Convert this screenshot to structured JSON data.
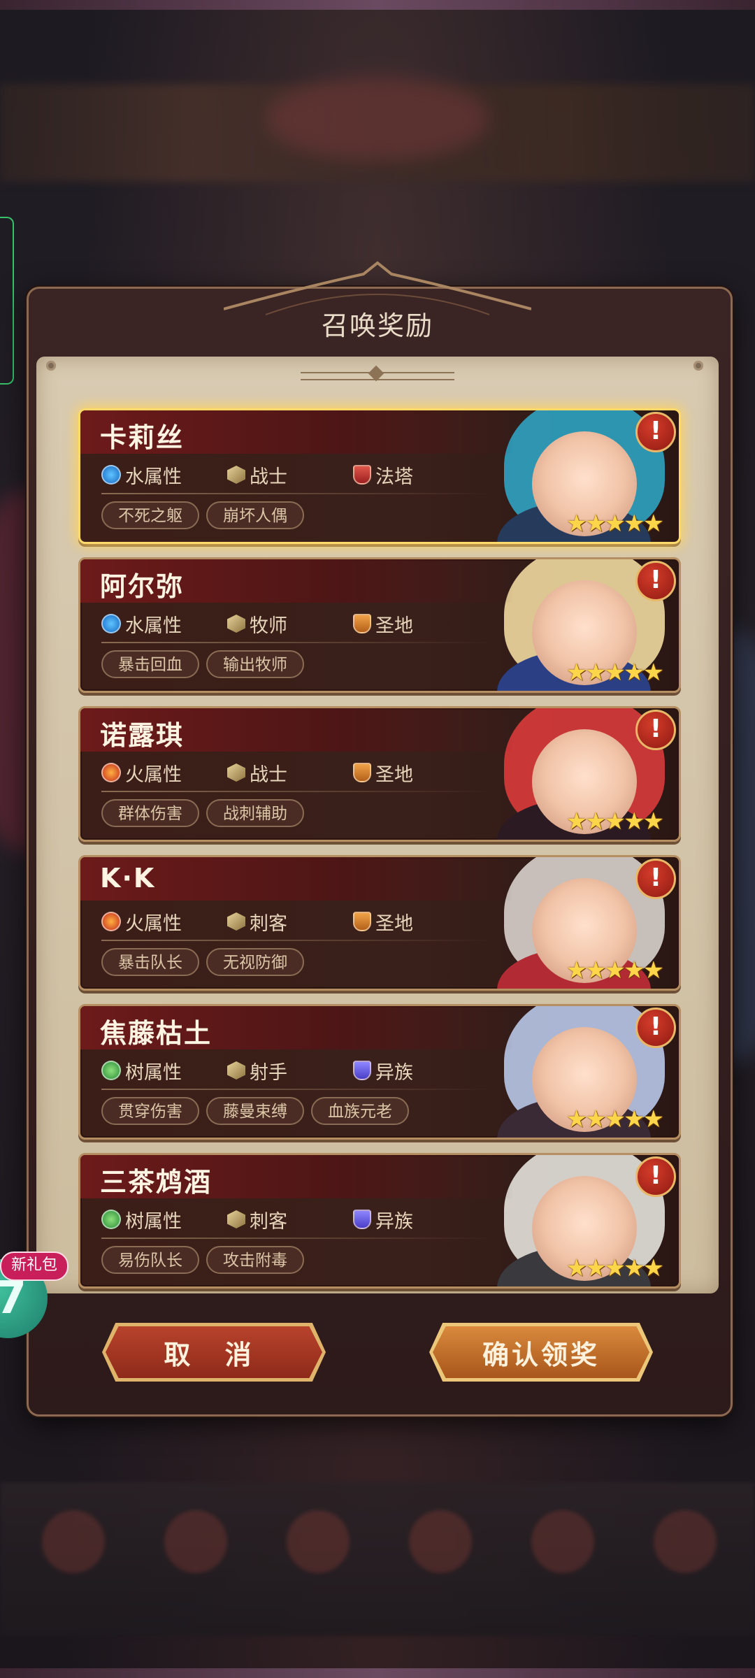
{
  "dialog": {
    "title": "召唤奖励",
    "cancel_label": "取 消",
    "confirm_label": "确认领奖"
  },
  "heroes": [
    {
      "name": "卡莉丝",
      "element": "水属性",
      "class": "战士",
      "faction": "法塔",
      "tags": [
        "不死之躯",
        "崩坏人偶"
      ],
      "stars": 5,
      "selected": true
    },
    {
      "name": "阿尔弥",
      "element": "水属性",
      "class": "牧师",
      "faction": "圣地",
      "tags": [
        "暴击回血",
        "输出牧师"
      ],
      "stars": 5,
      "selected": false
    },
    {
      "name": "诺露琪",
      "element": "火属性",
      "class": "战士",
      "faction": "圣地",
      "tags": [
        "群体伤害",
        "战刺辅助"
      ],
      "stars": 5,
      "selected": false
    },
    {
      "name": "K·K",
      "element": "火属性",
      "class": "刺客",
      "faction": "圣地",
      "tags": [
        "暴击队长",
        "无视防御"
      ],
      "stars": 5,
      "selected": false
    },
    {
      "name": "焦藤枯土",
      "element": "树属性",
      "class": "射手",
      "faction": "异族",
      "tags": [
        "贯穿伤害",
        "藤曼束缚",
        "血族元老"
      ],
      "stars": 5,
      "selected": false
    },
    {
      "name": "三茶鸩酒",
      "element": "树属性",
      "class": "刺客",
      "faction": "异族",
      "tags": [
        "易伤队长",
        "攻击附毒"
      ],
      "stars": 5,
      "selected": false
    }
  ],
  "alert_symbol": "!",
  "star_symbol": "★★★★★",
  "side_widget": {
    "gift_badge": "新礼包",
    "gift_number": "7"
  },
  "colors": {
    "selected_glow": "#ffd96a",
    "star": "#ffd64a",
    "alert": "#c0301f"
  }
}
